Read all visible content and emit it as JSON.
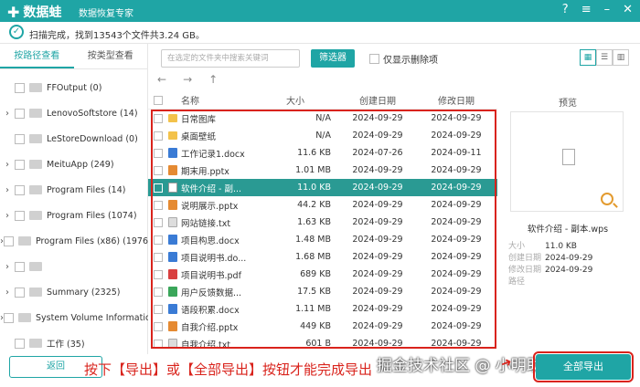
{
  "title": {
    "app": "数据蛙",
    "subtitle": "数据恢复专家"
  },
  "status": {
    "text": "扫描完成，找到13543个文件共3.24 GB。"
  },
  "sidebar": {
    "tabs": [
      "按路径查看",
      "按类型查看"
    ],
    "items": [
      {
        "label": "FFOutput (0)",
        "has_arrow": false
      },
      {
        "label": "LenovoSoftstore (14)",
        "has_arrow": true
      },
      {
        "label": "LeStoreDownload (0)",
        "has_arrow": false
      },
      {
        "label": "MeituApp (249)",
        "has_arrow": true
      },
      {
        "label": "Program Files (14)",
        "has_arrow": true
      },
      {
        "label": "Program Files (1074)",
        "has_arrow": true
      },
      {
        "label": "Program Files (x86) (1976)",
        "has_arrow": true
      },
      {
        "label": "",
        "has_arrow": true
      },
      {
        "label": "Summary (2325)",
        "has_arrow": true
      },
      {
        "label": "System Volume Informatio",
        "has_arrow": true
      },
      {
        "label": "工作 (35)",
        "has_arrow": false
      }
    ]
  },
  "toolbar": {
    "search_placeholder": "在选定的文件夹中搜索关键词",
    "filter_label": "筛选器",
    "deleted_only_label": "仅显示删除项"
  },
  "table": {
    "columns": [
      "名称",
      "大小",
      "创建日期",
      "修改日期"
    ],
    "rows": [
      {
        "name": "日常图库",
        "size": "N/A",
        "created": "2024-09-29",
        "modified": "2024-09-29",
        "type": "folder"
      },
      {
        "name": "桌面壁纸",
        "size": "N/A",
        "created": "2024-09-29",
        "modified": "2024-09-29",
        "type": "folder"
      },
      {
        "name": "工作记录1.docx",
        "size": "11.6 KB",
        "created": "2024-07-26",
        "modified": "2024-09-11",
        "type": "docx"
      },
      {
        "name": "期末用.pptx",
        "size": "1.01 MB",
        "created": "2024-09-29",
        "modified": "2024-09-29",
        "type": "pptx"
      },
      {
        "name": "软件介绍 - 副...",
        "size": "11.0 KB",
        "created": "2024-09-29",
        "modified": "2024-09-29",
        "type": "wps",
        "selected": true
      },
      {
        "name": "说明展示.pptx",
        "size": "44.2 KB",
        "created": "2024-09-29",
        "modified": "2024-09-29",
        "type": "pptx"
      },
      {
        "name": "网站链接.txt",
        "size": "1.63 KB",
        "created": "2024-09-29",
        "modified": "2024-09-29",
        "type": "txt"
      },
      {
        "name": "项目构思.docx",
        "size": "1.48 MB",
        "created": "2024-09-29",
        "modified": "2024-09-29",
        "type": "docx"
      },
      {
        "name": "项目说明书.do...",
        "size": "1.68 MB",
        "created": "2024-09-29",
        "modified": "2024-09-29",
        "type": "docx"
      },
      {
        "name": "项目说明书.pdf",
        "size": "689 KB",
        "created": "2024-09-29",
        "modified": "2024-09-29",
        "type": "pdf"
      },
      {
        "name": "用户反馈数据...",
        "size": "17.5 KB",
        "created": "2024-09-29",
        "modified": "2024-09-29",
        "type": "xlsx"
      },
      {
        "name": "语段积累.docx",
        "size": "1.11 MB",
        "created": "2024-09-29",
        "modified": "2024-09-29",
        "type": "docx"
      },
      {
        "name": "自我介绍.pptx",
        "size": "449 KB",
        "created": "2024-09-29",
        "modified": "2024-09-29",
        "type": "pptx"
      },
      {
        "name": "自我介绍.txt",
        "size": "601 B",
        "created": "2024-09-29",
        "modified": "2024-09-29",
        "type": "txt"
      }
    ]
  },
  "preview": {
    "title": "预览",
    "filename": "软件介绍 - 副本.wps",
    "size_label": "大小",
    "size": "11.0 KB",
    "created_label": "创建日期",
    "created": "2024-09-29",
    "modified_label": "修改日期",
    "modified": "2024-09-29",
    "path_label": "路径"
  },
  "bottom": {
    "back_label": "返回",
    "instruction": "按下【导出】或【全部导出】按钮才能完成导出",
    "watermark": "掘金技术社区 @ 小明助手",
    "export_label": "全部导出"
  },
  "colors": {
    "accent": "#1fa5a5",
    "highlight": "#d9231c"
  }
}
